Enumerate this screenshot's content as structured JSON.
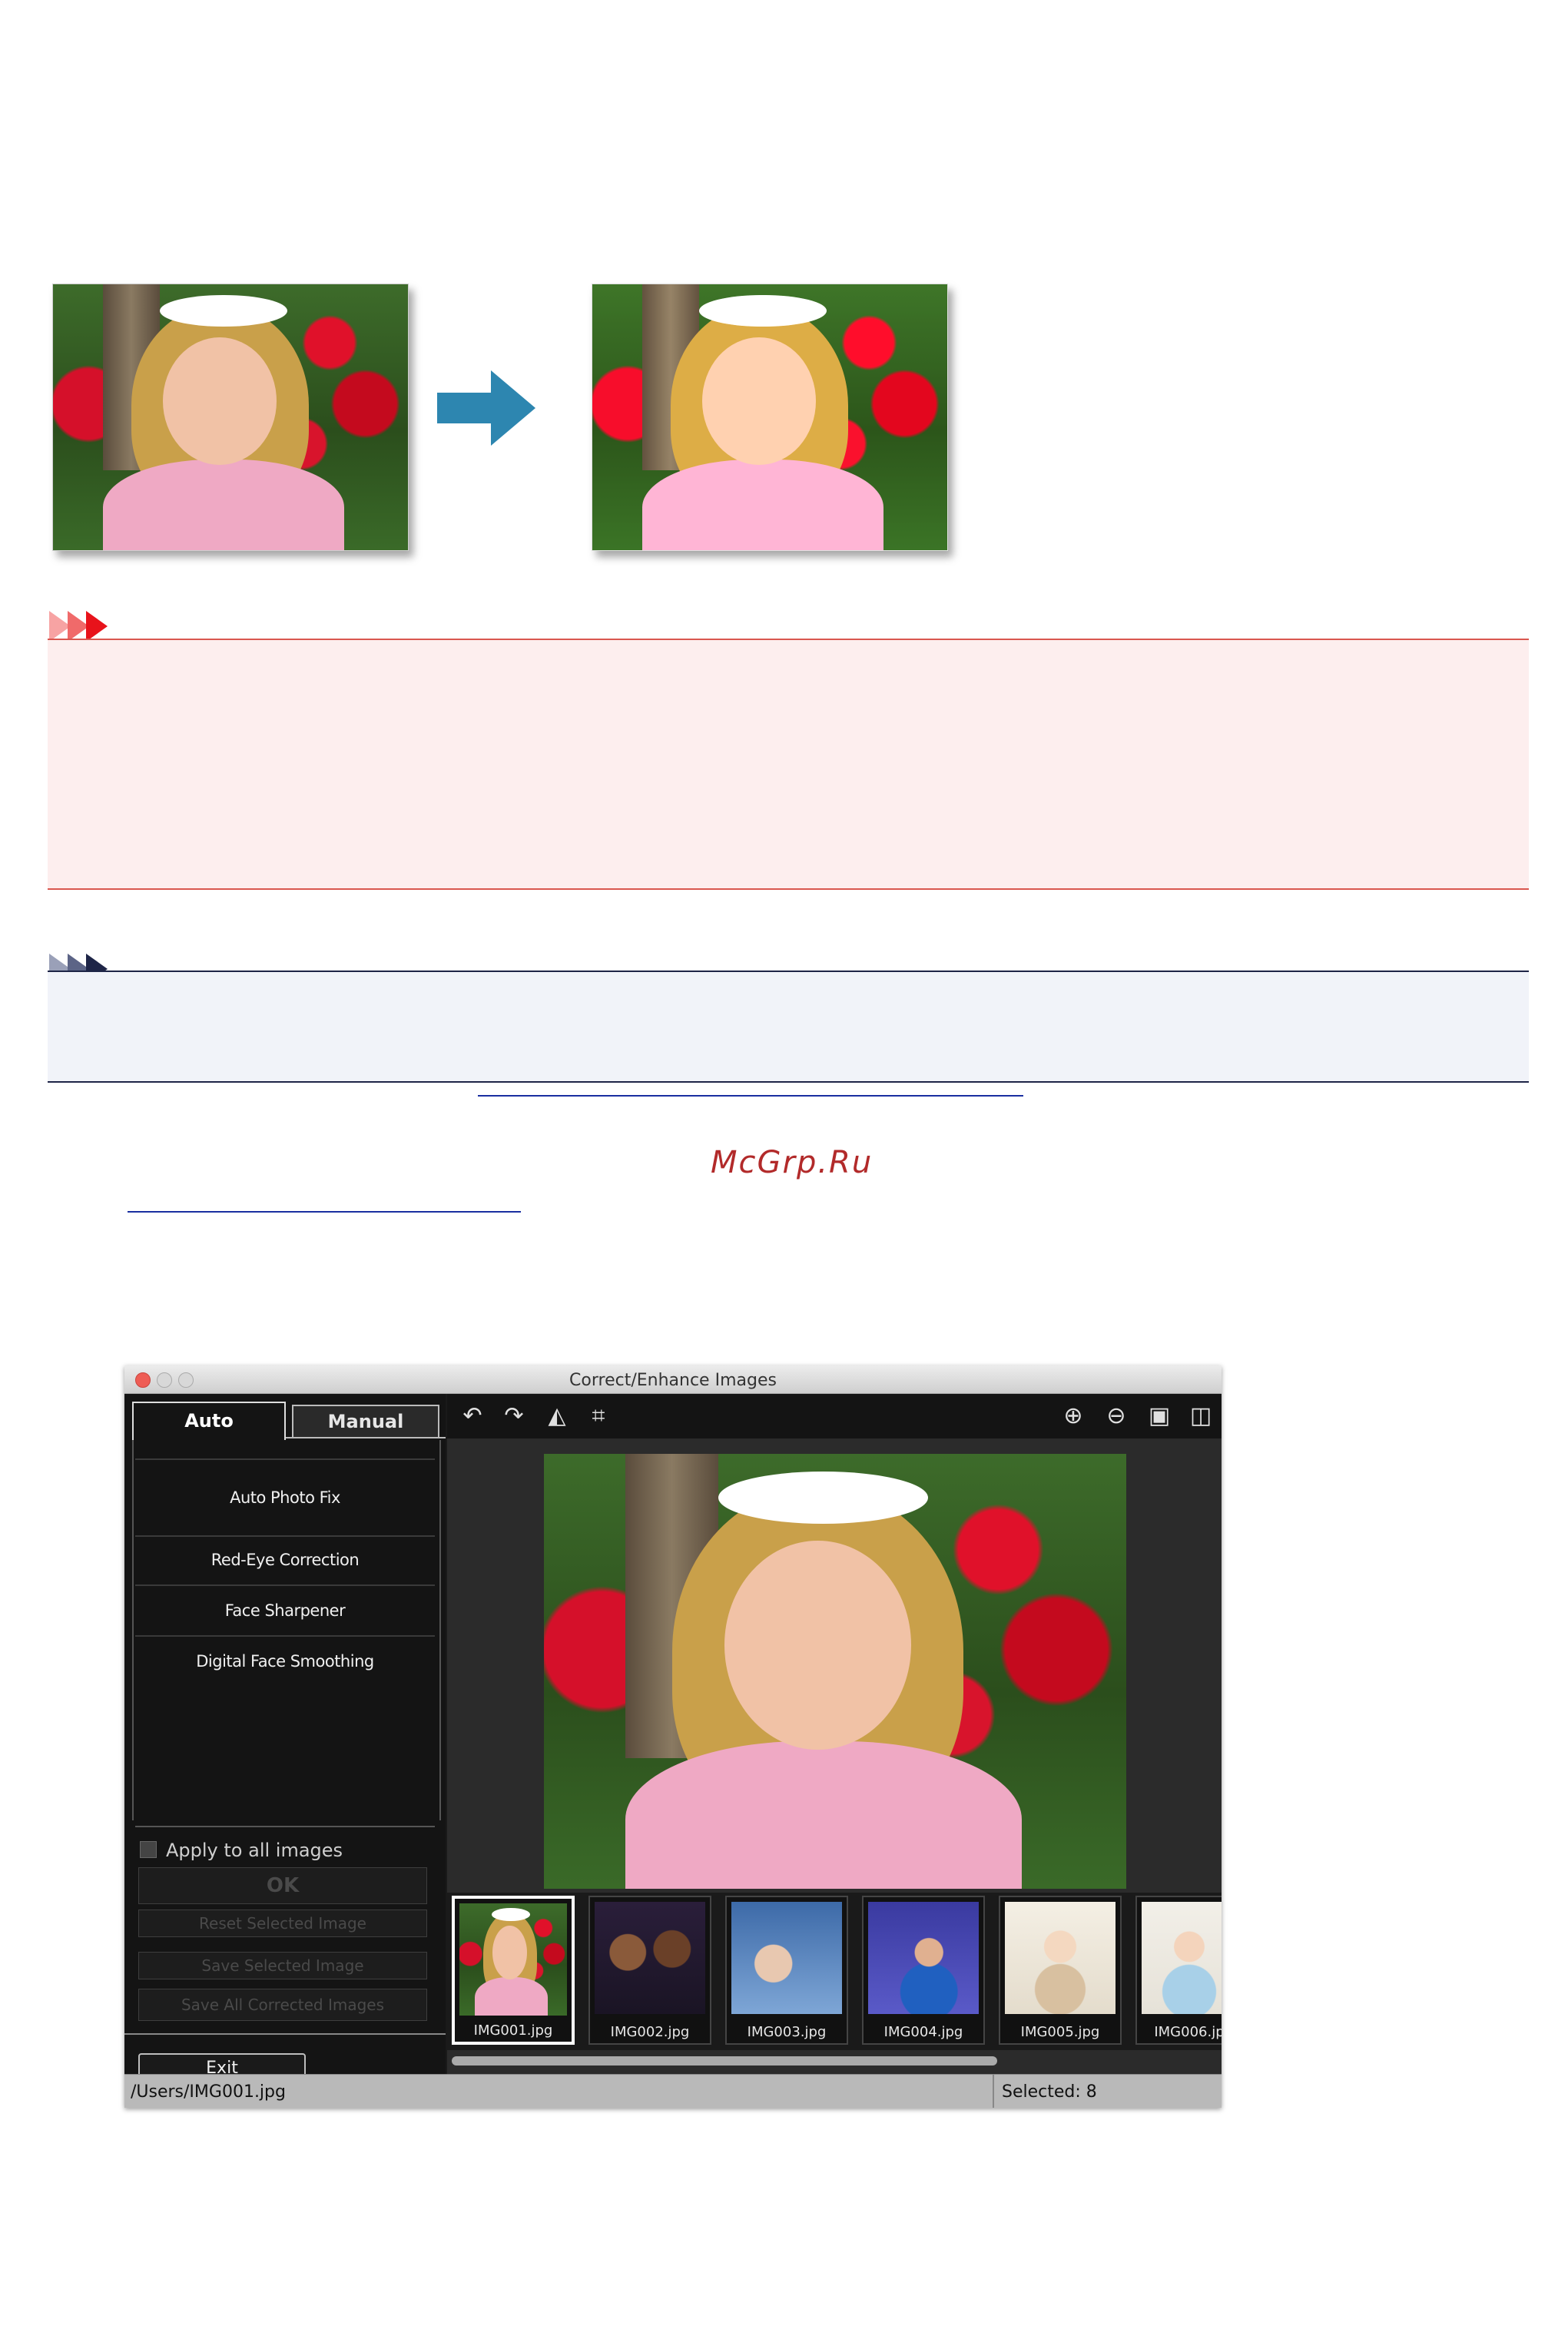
{
  "watermark": "McGrp.Ru",
  "window": {
    "title": "Correct/Enhance Images",
    "tabs": {
      "auto": "Auto",
      "manual": "Manual"
    },
    "functions": [
      "Auto Photo Fix",
      "Red-Eye Correction",
      "Face Sharpener",
      "Digital Face Smoothing"
    ],
    "apply_all": "Apply to all images",
    "ok": "OK",
    "reset": "Reset Selected Image",
    "save_selected": "Save Selected Image",
    "save_all": "Save All Corrected Images",
    "exit": "Exit",
    "thumbnails": [
      "IMG001.jpg",
      "IMG002.jpg",
      "IMG003.jpg",
      "IMG004.jpg",
      "IMG005.jpg",
      "IMG006.jp"
    ],
    "status_path": "/Users/IMG001.jpg",
    "status_selected": "Selected: 8"
  },
  "colors": {
    "arrow": "#2d86b0",
    "caution_accent": "#d9574f",
    "note_accent": "#1e2547",
    "link": "#1a2fa0"
  },
  "icons": {
    "toolbar_left": [
      "rotate-left-icon",
      "rotate-right-icon",
      "flip-icon",
      "crop-icon"
    ],
    "toolbar_right": [
      "zoom-in-icon",
      "zoom-out-icon",
      "full-screen-icon",
      "compare-icon"
    ]
  }
}
